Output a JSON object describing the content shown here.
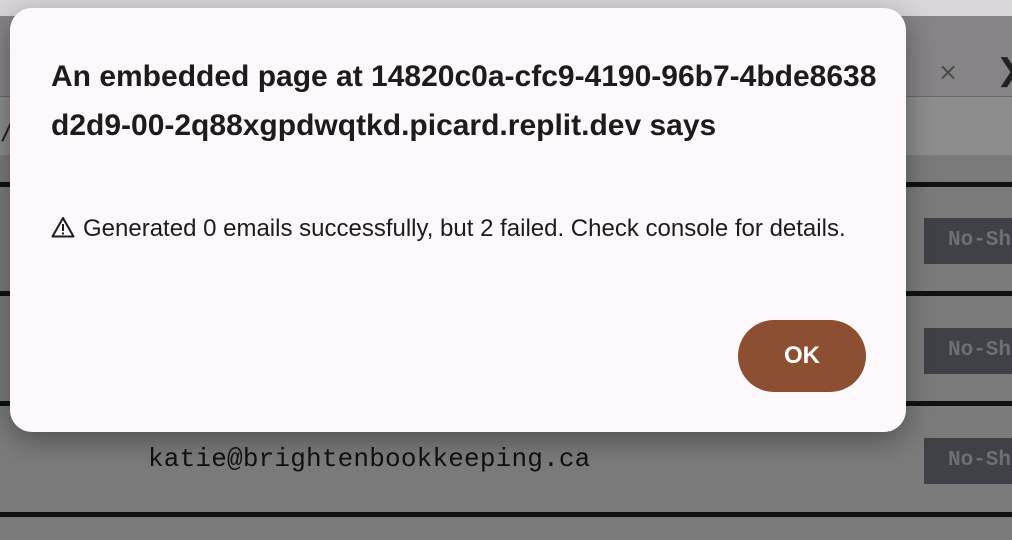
{
  "background": {
    "close_glyph": "×",
    "next_glyph": "❯",
    "slash_glyph": "/",
    "visible_email": "katie@brightenbookkeeping.ca",
    "row_action_label": "No-Show"
  },
  "dialog": {
    "title": "An embedded page at 14820c0a-cfc9-4190-96b7-4bde8638d2d9-00-2q88xgpdwqtkd.picard.replit.dev says",
    "message": "Generated 0 emails successfully, but 2 failed. Check console for details.",
    "ok_label": "OK"
  },
  "colors": {
    "ok_button": "#8c4f32",
    "dialog_bg": "#fdf8fb"
  },
  "icons": [
    "warning-icon",
    "close-icon",
    "chevron-right-icon"
  ]
}
